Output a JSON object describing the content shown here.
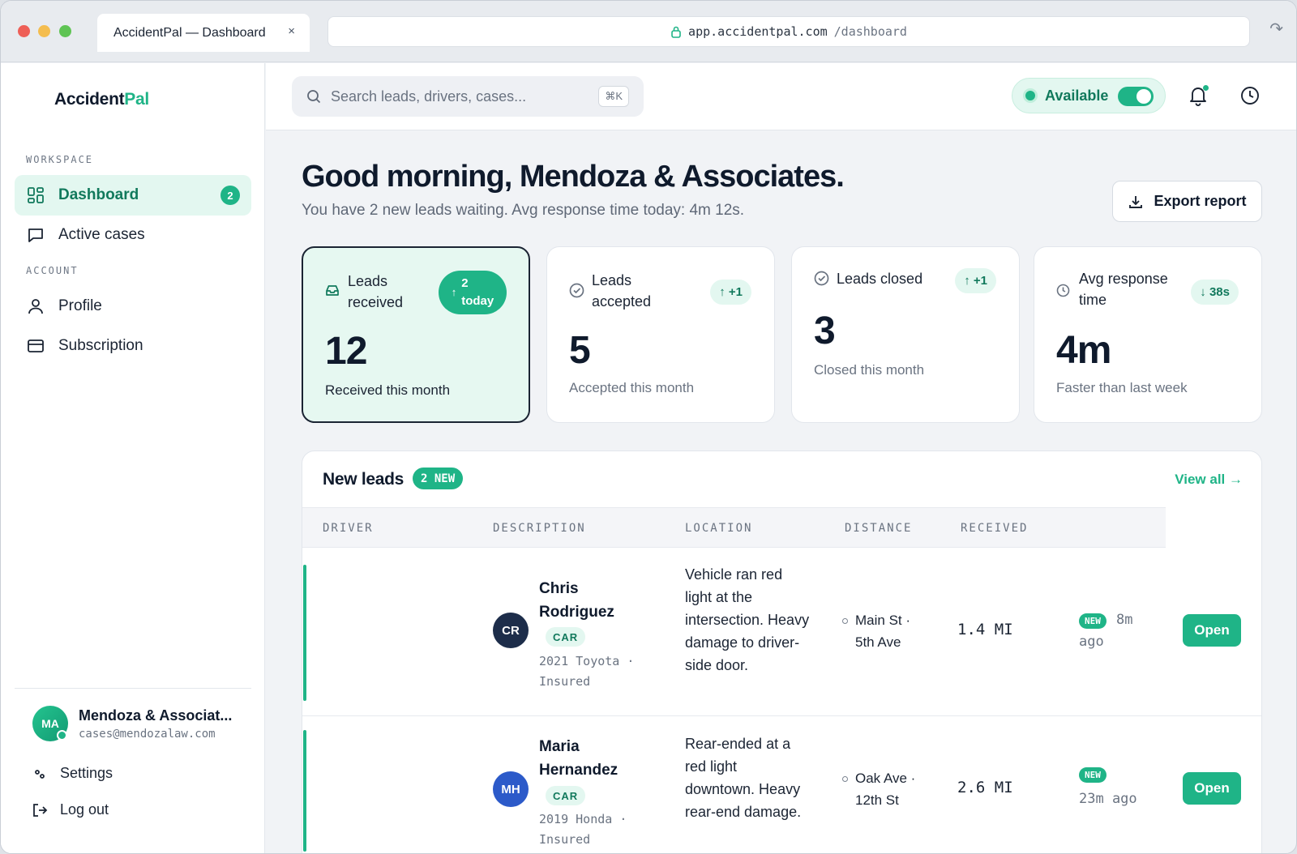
{
  "browser": {
    "tab_title": "AccidentPal — Dashboard",
    "tab_close": "×",
    "url_host": "app.accidentpal.com",
    "url_path": "/dashboard"
  },
  "sidebar": {
    "logo_main": "Accident",
    "logo_accent": "Pal",
    "workspace_label": "WORKSPACE",
    "account_label": "ACCOUNT",
    "items": [
      {
        "label": "Dashboard",
        "badge": "2",
        "icon": "grid-icon"
      },
      {
        "label": "Active cases",
        "icon": "chat-icon"
      },
      {
        "label": "Profile",
        "icon": "user-icon"
      },
      {
        "label": "Subscription",
        "icon": "card-icon"
      }
    ],
    "user": {
      "initials": "MA",
      "name": "Mendoza & Associat...",
      "email": "cases@mendozalaw.com"
    },
    "settings_label": "Settings",
    "logout_label": "Log out"
  },
  "topbar": {
    "search_placeholder": "Search leads, drivers, cases...",
    "shortcut": "⌘K",
    "availability_label": "Available",
    "availability_on": true
  },
  "main": {
    "greeting": "Good morning, Mendoza & Associates.",
    "subtitle": "You have 2 new leads waiting. Avg response time today: 4m 12s.",
    "export_label": "Export report"
  },
  "stats": [
    {
      "label_l1": "Leads",
      "label_l2": "received",
      "delta_l1": "2",
      "delta_l2": "today",
      "value": "12",
      "note": "Received this month",
      "icon": "inbox-icon"
    },
    {
      "label_l1": "Leads",
      "label_l2": "accepted",
      "delta": "+1",
      "value": "5",
      "note": "Accepted this month",
      "icon": "check-circle-icon"
    },
    {
      "label_l1": "Leads closed",
      "delta": "+1",
      "value": "3",
      "note": "Closed this month",
      "icon": "check-circle-icon"
    },
    {
      "label_l1": "Avg response",
      "label_l2": "time",
      "delta": "38s",
      "value": "4m",
      "note": "Faster than last week",
      "icon": "clock-icon"
    }
  ],
  "leads": {
    "title": "New leads",
    "new_count": "2 NEW",
    "view_all": "View all →",
    "columns": [
      "DRIVER",
      "DESCRIPTION",
      "LOCATION",
      "DISTANCE",
      "RECEIVED"
    ],
    "rows": [
      {
        "initials": "CR",
        "name_l1": "Chris",
        "name_l2": "Rodriguez",
        "vehicle_type": "CAR",
        "vehicle_l1": "2021 Toyota ·",
        "vehicle_l2": "Insured",
        "description": "Vehicle ran red light at the intersection. Heavy damage to driver-side door.",
        "location": "Main St · 5th Ave",
        "distance": "1.4 MI",
        "received_badge": "NEW",
        "received": "8m ago",
        "action": "Open",
        "avatar_color": "#1d2d4a"
      },
      {
        "initials": "MH",
        "name_l1": "Maria",
        "name_l2": "Hernandez",
        "vehicle_type": "CAR",
        "vehicle_l1": "2019 Honda ·",
        "vehicle_l2": "Insured",
        "description": "Rear-ended at a red light downtown. Heavy rear-end damage.",
        "location": "Oak Ave · 12th St",
        "distance": "2.6 MI",
        "received_badge": "NEW",
        "received": "23m ago",
        "action": "Open",
        "avatar_color": "#2c5ac9"
      }
    ]
  }
}
